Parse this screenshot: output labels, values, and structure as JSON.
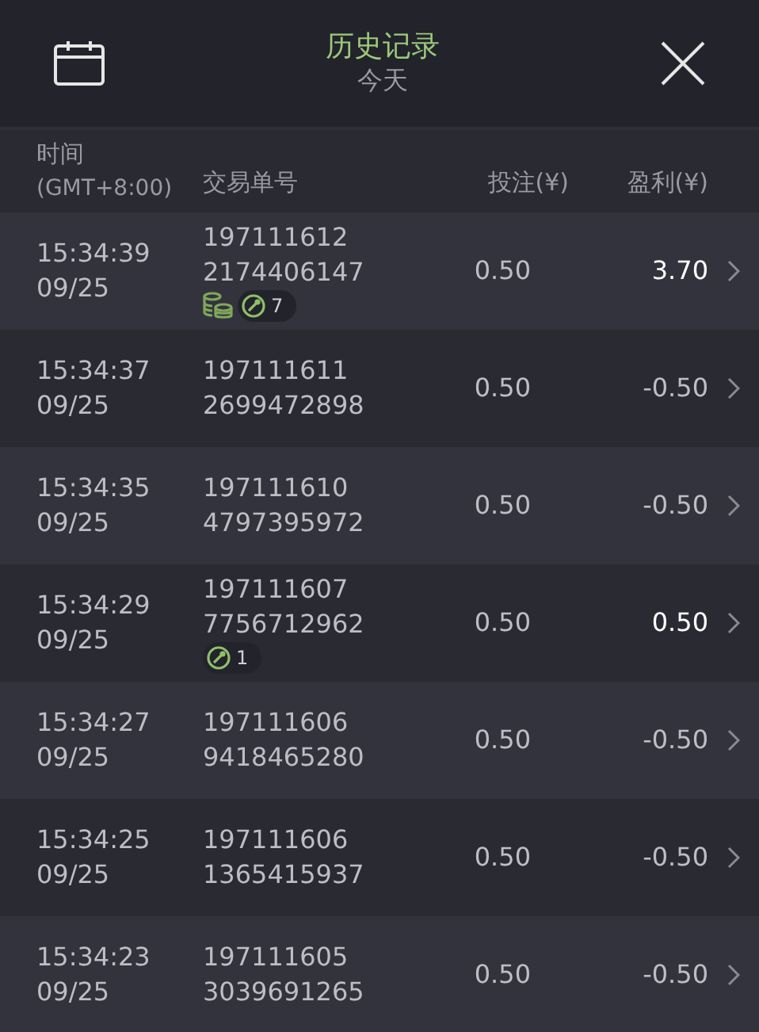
{
  "header": {
    "title": "历史记录",
    "subtitle": "今天"
  },
  "columns": [
    "时间",
    "(GMT+8:00)",
    "交易单号",
    "投注(¥)",
    "盈利(¥)"
  ],
  "rows": [
    {
      "time": "15:34:39",
      "date": "09/25",
      "order_1": "197111612",
      "order_2": "2174406147",
      "coins": true,
      "count": "7",
      "stake": "0.50",
      "profit": "3.70",
      "won": true
    },
    {
      "time": "15:34:37",
      "date": "09/25",
      "order_1": "197111611",
      "order_2": "2699472898",
      "coins": false,
      "stake": "0.50",
      "profit": "-0.50",
      "won": false
    },
    {
      "time": "15:34:35",
      "date": "09/25",
      "order_1": "197111610",
      "order_2": "4797395972",
      "coins": false,
      "stake": "0.50",
      "profit": "-0.50",
      "won": false
    },
    {
      "time": "15:34:29",
      "date": "09/25",
      "order_1": "197111607",
      "order_2": "7756712962",
      "coins": false,
      "count": "1",
      "stake": "0.50",
      "profit": "0.50",
      "won": true
    },
    {
      "time": "15:34:27",
      "date": "09/25",
      "order_1": "197111606",
      "order_2": "9418465280",
      "coins": false,
      "stake": "0.50",
      "profit": "-0.50",
      "won": false
    },
    {
      "time": "15:34:25",
      "date": "09/25",
      "order_1": "197111606",
      "order_2": "1365415937",
      "coins": false,
      "stake": "0.50",
      "profit": "-0.50",
      "won": false
    },
    {
      "time": "15:34:23",
      "date": "09/25",
      "order_1": "197111605",
      "order_2": "3039691265",
      "coins": false,
      "stake": "0.50",
      "profit": "-0.50",
      "won": false
    }
  ]
}
